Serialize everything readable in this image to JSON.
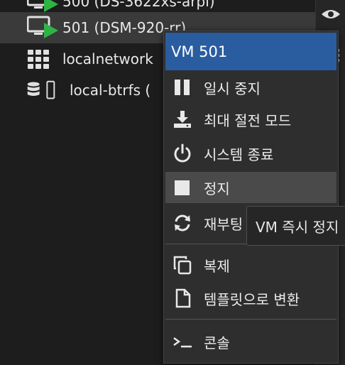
{
  "tree": {
    "items": [
      {
        "label": "500 (DS-3622xs-arpl)"
      },
      {
        "label": "501 (DSM-920-rr)"
      },
      {
        "label": "localnetwork"
      },
      {
        "label": "local-btrfs ("
      }
    ]
  },
  "menu": {
    "title": "VM 501",
    "items": [
      {
        "label": "일시 중지",
        "icon": "pause-icon"
      },
      {
        "label": "최대 절전 모드",
        "icon": "download-icon"
      },
      {
        "label": "시스템 종료",
        "icon": "power-icon"
      },
      {
        "label": "정지",
        "icon": "stop-icon"
      },
      {
        "label": "재부팅",
        "icon": "refresh-icon"
      },
      {
        "label": "복제",
        "icon": "clone-icon"
      },
      {
        "label": "템플릿으로 변환",
        "icon": "file-icon"
      },
      {
        "label": "콘솔",
        "icon": "terminal-icon"
      }
    ]
  },
  "tooltip": {
    "text": "VM 즉시 정지"
  },
  "colors": {
    "header": "#2a5ca0",
    "hover": "#4a4a4a",
    "running": "#2fb344"
  }
}
